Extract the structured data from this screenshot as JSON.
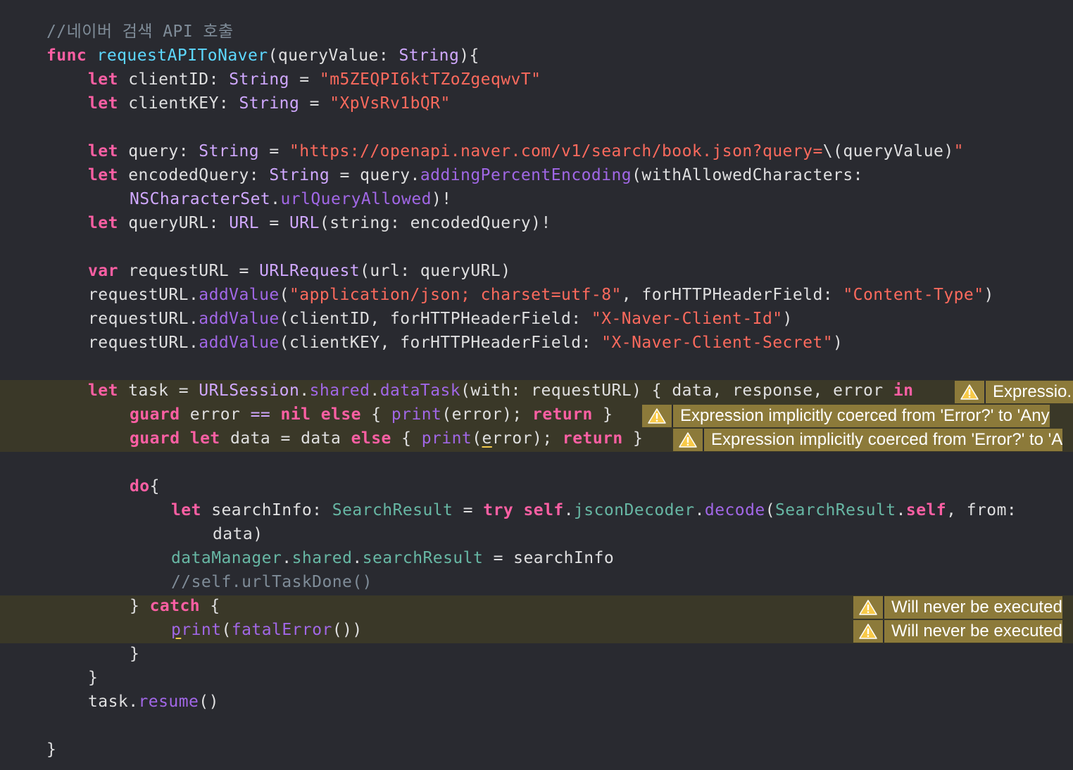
{
  "code_lines": [
    [
      {
        "t": "cmt",
        "v": "//네이버 검색 API 호출"
      }
    ],
    [
      {
        "t": "kw",
        "v": "func"
      },
      {
        "t": "ident",
        "v": " "
      },
      {
        "t": "decl",
        "v": "requestAPIToNaver"
      },
      {
        "t": "ident",
        "v": "(queryValue: "
      },
      {
        "t": "ty",
        "v": "String"
      },
      {
        "t": "ident",
        "v": "){"
      }
    ],
    [
      {
        "t": "kw",
        "v": "let"
      },
      {
        "t": "ident",
        "v": " clientID: "
      },
      {
        "t": "ty",
        "v": "String"
      },
      {
        "t": "ident",
        "v": " = "
      },
      {
        "t": "str",
        "v": "\"m5ZEQPI6ktTZoZgeqwvT\""
      }
    ],
    [
      {
        "t": "kw",
        "v": "let"
      },
      {
        "t": "ident",
        "v": " clientKEY: "
      },
      {
        "t": "ty",
        "v": "String"
      },
      {
        "t": "ident",
        "v": " = "
      },
      {
        "t": "str",
        "v": "\"XpVsRv1bQR\""
      }
    ],
    [],
    [
      {
        "t": "kw",
        "v": "let"
      },
      {
        "t": "ident",
        "v": " query: "
      },
      {
        "t": "ty",
        "v": "String"
      },
      {
        "t": "ident",
        "v": " = "
      },
      {
        "t": "str",
        "v": "\"https://openapi.naver.com/v1/search/book.json?query="
      },
      {
        "t": "ident",
        "v": "\\(queryValue)"
      },
      {
        "t": "str",
        "v": "\""
      }
    ],
    [
      {
        "t": "kw",
        "v": "let"
      },
      {
        "t": "ident",
        "v": " encodedQuery: "
      },
      {
        "t": "ty",
        "v": "String"
      },
      {
        "t": "ident",
        "v": " = query."
      },
      {
        "t": "fn",
        "v": "addingPercentEncoding"
      },
      {
        "t": "ident",
        "v": "(withAllowedCharacters:"
      }
    ],
    [
      {
        "t": "ty",
        "v": "NSCharacterSet"
      },
      {
        "t": "ident",
        "v": "."
      },
      {
        "t": "fn",
        "v": "urlQueryAllowed"
      },
      {
        "t": "ident",
        "v": ")!"
      }
    ],
    [
      {
        "t": "kw",
        "v": "let"
      },
      {
        "t": "ident",
        "v": " queryURL: "
      },
      {
        "t": "ty",
        "v": "URL"
      },
      {
        "t": "ident",
        "v": " = "
      },
      {
        "t": "ty",
        "v": "URL"
      },
      {
        "t": "ident",
        "v": "(string: encodedQuery)!"
      }
    ],
    [],
    [
      {
        "t": "kw",
        "v": "var"
      },
      {
        "t": "ident",
        "v": " requestURL = "
      },
      {
        "t": "ty",
        "v": "URLRequest"
      },
      {
        "t": "ident",
        "v": "(url: queryURL)"
      }
    ],
    [
      {
        "t": "ident",
        "v": "requestURL."
      },
      {
        "t": "fn",
        "v": "addValue"
      },
      {
        "t": "ident",
        "v": "("
      },
      {
        "t": "str",
        "v": "\"application/json; charset=utf-8\""
      },
      {
        "t": "ident",
        "v": ", forHTTPHeaderField: "
      },
      {
        "t": "str",
        "v": "\"Content-Type\""
      },
      {
        "t": "ident",
        "v": ")"
      }
    ],
    [
      {
        "t": "ident",
        "v": "requestURL."
      },
      {
        "t": "fn",
        "v": "addValue"
      },
      {
        "t": "ident",
        "v": "(clientID, forHTTPHeaderField: "
      },
      {
        "t": "str",
        "v": "\"X-Naver-Client-Id\""
      },
      {
        "t": "ident",
        "v": ")"
      }
    ],
    [
      {
        "t": "ident",
        "v": "requestURL."
      },
      {
        "t": "fn",
        "v": "addValue"
      },
      {
        "t": "ident",
        "v": "(clientKEY, forHTTPHeaderField: "
      },
      {
        "t": "str",
        "v": "\"X-Naver-Client-Secret\""
      },
      {
        "t": "ident",
        "v": ")"
      }
    ],
    [],
    [
      {
        "t": "kw",
        "v": "let"
      },
      {
        "t": "ident",
        "v": " task = "
      },
      {
        "t": "ty",
        "v": "URLSession"
      },
      {
        "t": "ident",
        "v": "."
      },
      {
        "t": "fn",
        "v": "shared"
      },
      {
        "t": "ident",
        "v": "."
      },
      {
        "t": "fn",
        "v": "dataTask"
      },
      {
        "t": "ident",
        "v": "(with: requestURL) { data, response, error "
      },
      {
        "t": "kw",
        "v": "in"
      }
    ],
    [
      {
        "t": "kw",
        "v": "guard"
      },
      {
        "t": "ident",
        "v": " error "
      },
      {
        "t": "ty",
        "v": "=="
      },
      {
        "t": "ident",
        "v": " "
      },
      {
        "t": "kw",
        "v": "nil"
      },
      {
        "t": "ident",
        "v": " "
      },
      {
        "t": "kw",
        "v": "else"
      },
      {
        "t": "ident",
        "v": " { "
      },
      {
        "t": "fn",
        "v": "print"
      },
      {
        "t": "ident",
        "v": "(error); "
      },
      {
        "t": "kw",
        "v": "return"
      },
      {
        "t": "ident",
        "v": " }"
      }
    ],
    [
      {
        "t": "kw",
        "v": "guard"
      },
      {
        "t": "ident",
        "v": " "
      },
      {
        "t": "kw",
        "v": "let"
      },
      {
        "t": "ident",
        "v": " data = data "
      },
      {
        "t": "kw",
        "v": "else"
      },
      {
        "t": "ident",
        "v": " { "
      },
      {
        "t": "fn",
        "v": "print"
      },
      {
        "t": "ident",
        "v": "("
      },
      {
        "t": "ident",
        "v": "e",
        "u": true
      },
      {
        "t": "ident",
        "v": "rror); "
      },
      {
        "t": "kw",
        "v": "return"
      },
      {
        "t": "ident",
        "v": " }"
      }
    ],
    [],
    [
      {
        "t": "kw",
        "v": "do"
      },
      {
        "t": "ident",
        "v": "{"
      }
    ],
    [
      {
        "t": "kw",
        "v": "let"
      },
      {
        "t": "ident",
        "v": " searchInfo: "
      },
      {
        "t": "prop",
        "v": "SearchResult"
      },
      {
        "t": "ident",
        "v": " = "
      },
      {
        "t": "kw",
        "v": "try"
      },
      {
        "t": "ident",
        "v": " "
      },
      {
        "t": "kw",
        "v": "self"
      },
      {
        "t": "ident",
        "v": "."
      },
      {
        "t": "prop",
        "v": "jsconDecoder"
      },
      {
        "t": "ident",
        "v": "."
      },
      {
        "t": "fn",
        "v": "decode"
      },
      {
        "t": "ident",
        "v": "("
      },
      {
        "t": "prop",
        "v": "SearchResult"
      },
      {
        "t": "ident",
        "v": "."
      },
      {
        "t": "kw",
        "v": "self"
      },
      {
        "t": "ident",
        "v": ", from:"
      }
    ],
    [
      {
        "t": "ident",
        "v": "data)"
      }
    ],
    [
      {
        "t": "prop",
        "v": "dataManager"
      },
      {
        "t": "ident",
        "v": "."
      },
      {
        "t": "prop",
        "v": "shared"
      },
      {
        "t": "ident",
        "v": "."
      },
      {
        "t": "prop",
        "v": "searchResult"
      },
      {
        "t": "ident",
        "v": " = searchInfo"
      }
    ],
    [
      {
        "t": "cmt",
        "v": "//self.urlTaskDone()"
      }
    ],
    [
      {
        "t": "ident",
        "v": "} "
      },
      {
        "t": "kw",
        "v": "catch"
      },
      {
        "t": "ident",
        "v": " {"
      }
    ],
    [
      {
        "t": "fn",
        "v": "p",
        "u": true
      },
      {
        "t": "fn",
        "v": "rint"
      },
      {
        "t": "ident",
        "v": "("
      },
      {
        "t": "fn",
        "v": "fatalError"
      },
      {
        "t": "ident",
        "v": "())"
      }
    ],
    [
      {
        "t": "ident",
        "v": "}"
      }
    ],
    [
      {
        "t": "ident",
        "v": "}"
      }
    ],
    [
      {
        "t": "ident",
        "v": "task."
      },
      {
        "t": "fn",
        "v": "resume"
      },
      {
        "t": "ident",
        "v": "()"
      }
    ],
    [],
    [
      {
        "t": "ident",
        "v": "}"
      }
    ]
  ],
  "warnings": [
    {
      "text": "Expressio..."
    },
    {
      "text": "Expression implicitly coerced from 'Error?' to 'Any"
    },
    {
      "text": "Expression implicitly coerced from 'Error?' to 'A"
    },
    {
      "text": "Will never be executed"
    },
    {
      "text": "Will never be executed"
    }
  ],
  "colors": {
    "background": "#292a30",
    "warning_highlight": "#3a3828",
    "warning_badge": "#8c7a3a",
    "keyword": "#fc5fa3",
    "string": "#fc6a5d",
    "comment": "#7f8c98"
  },
  "icons": {
    "warning": "warning-triangle-icon"
  }
}
